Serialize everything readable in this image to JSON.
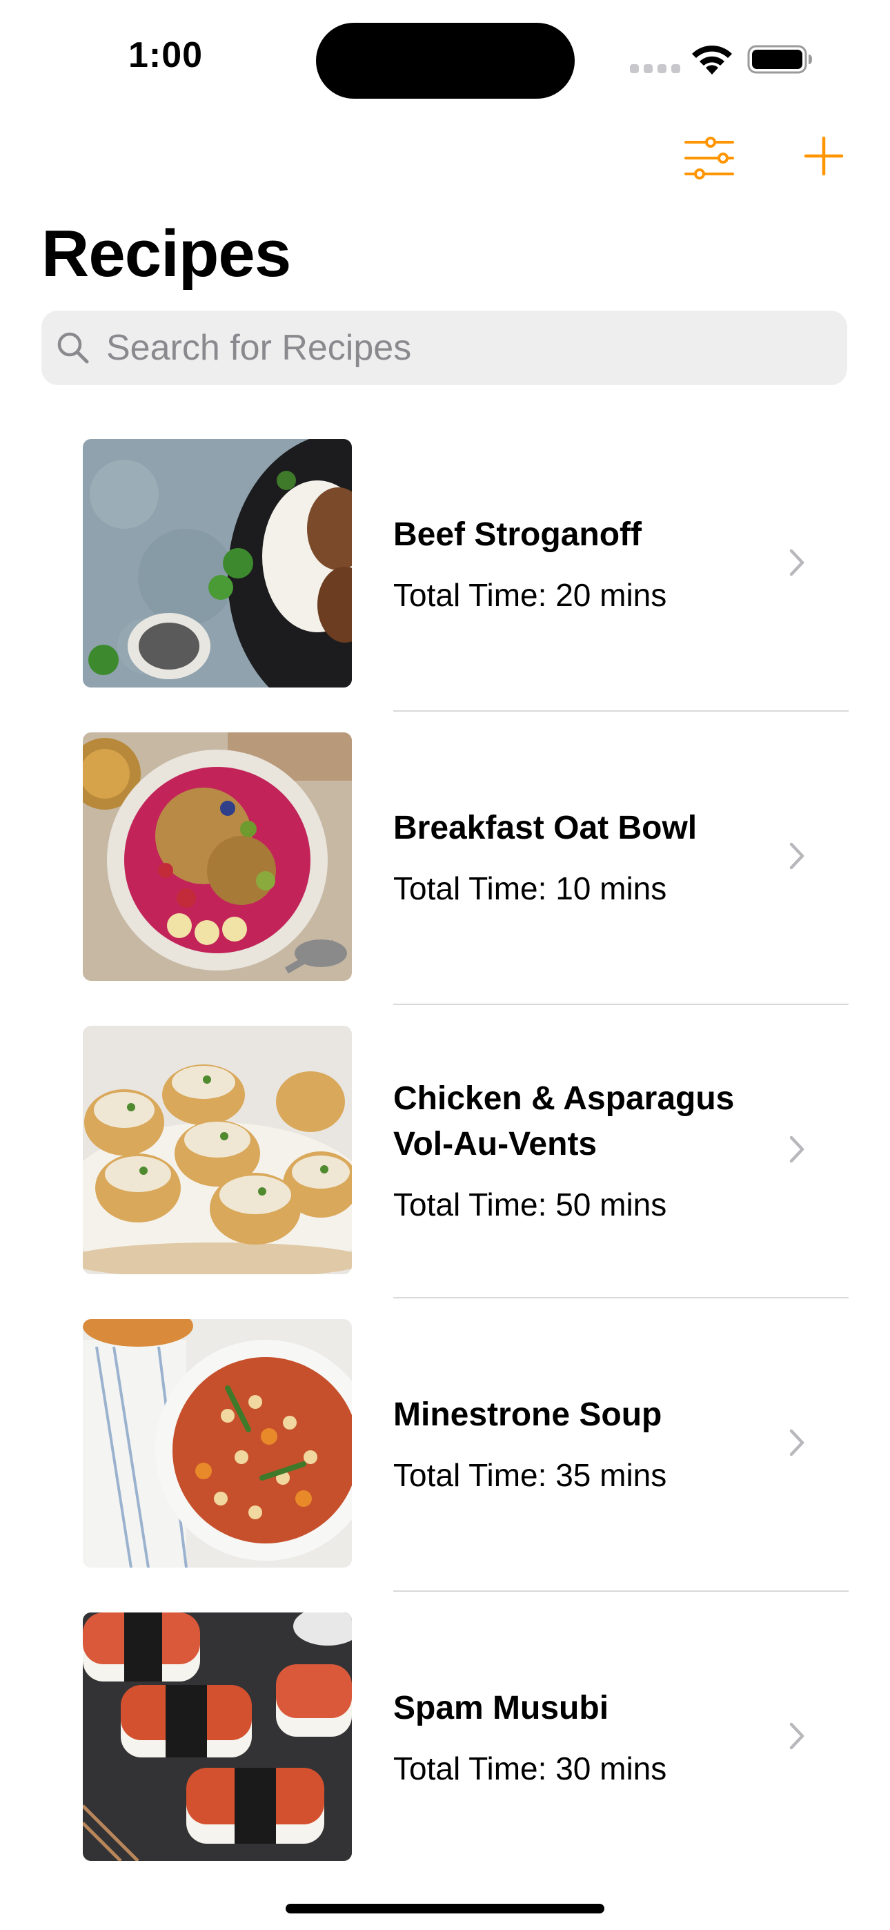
{
  "status_bar": {
    "time": "1:00"
  },
  "toolbar": {
    "filter_icon": "sliders-icon",
    "add_icon": "plus-icon",
    "accent_color": "#FF9500"
  },
  "page": {
    "title": "Recipes"
  },
  "search": {
    "placeholder": "Search for Recipes",
    "value": ""
  },
  "recipes": [
    {
      "name": "Beef Stroganoff",
      "total_time": "Total Time: 20 mins"
    },
    {
      "name": "Breakfast Oat Bowl",
      "total_time": "Total Time: 10 mins"
    },
    {
      "name": "Chicken & Asparagus Vol-Au-Vents",
      "total_time": "Total Time: 50 mins"
    },
    {
      "name": "Minestrone Soup",
      "total_time": "Total Time: 35 mins"
    },
    {
      "name": "Spam Musubi",
      "total_time": "Total Time: 30 mins"
    }
  ]
}
